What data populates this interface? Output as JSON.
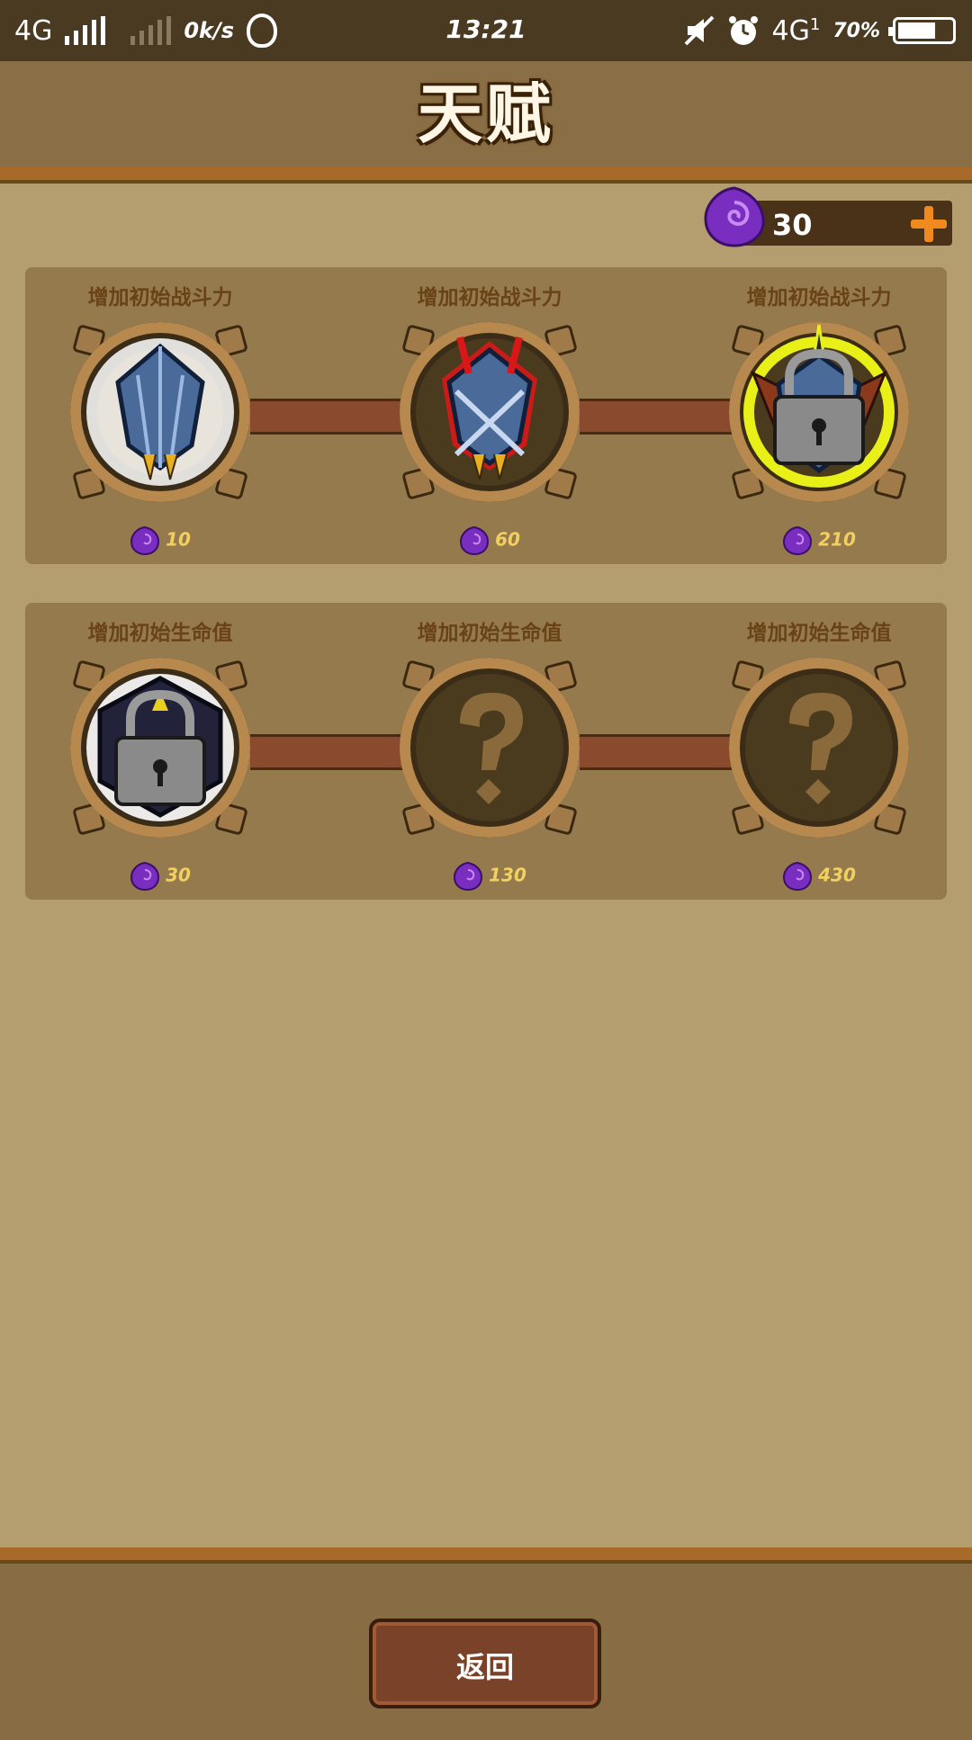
{
  "status_bar": {
    "network_left": "4G",
    "speed": "0k/s",
    "time": "13:21",
    "network_right": "4G",
    "network_right_sub": "1",
    "battery_text": "70%"
  },
  "header": {
    "title": "天赋"
  },
  "currency": {
    "amount": "30",
    "icon": "purple-gem-icon",
    "add_icon": "plus-icon"
  },
  "talents": [
    {
      "nodes": [
        {
          "label": "增加初始战斗力",
          "cost": "10",
          "icon": "blue-shield-icon",
          "state": "active-white"
        },
        {
          "label": "增加初始战斗力",
          "cost": "60",
          "icon": "blue-shield-crossed-swords-icon",
          "state": "active-red"
        },
        {
          "label": "增加初始战斗力",
          "cost": "210",
          "icon": "winged-shield-lock-icon",
          "state": "locked-yellow"
        }
      ]
    },
    {
      "nodes": [
        {
          "label": "增加初始生命值",
          "cost": "30",
          "icon": "dark-hexagon-lock-icon",
          "state": "locked-white"
        },
        {
          "label": "增加初始生命值",
          "cost": "130",
          "icon": "question-mark-icon",
          "state": "unknown"
        },
        {
          "label": "增加初始生命值",
          "cost": "430",
          "icon": "question-mark-icon",
          "state": "unknown"
        }
      ]
    }
  ],
  "footer": {
    "back_label": "返回"
  },
  "colors": {
    "background": "#b49e70",
    "panel": "#957a4e",
    "label": "#6a4218",
    "cost": "#f2d060",
    "accent_orange": "#f08a1e",
    "gem_purple": "#8a3ad0"
  }
}
